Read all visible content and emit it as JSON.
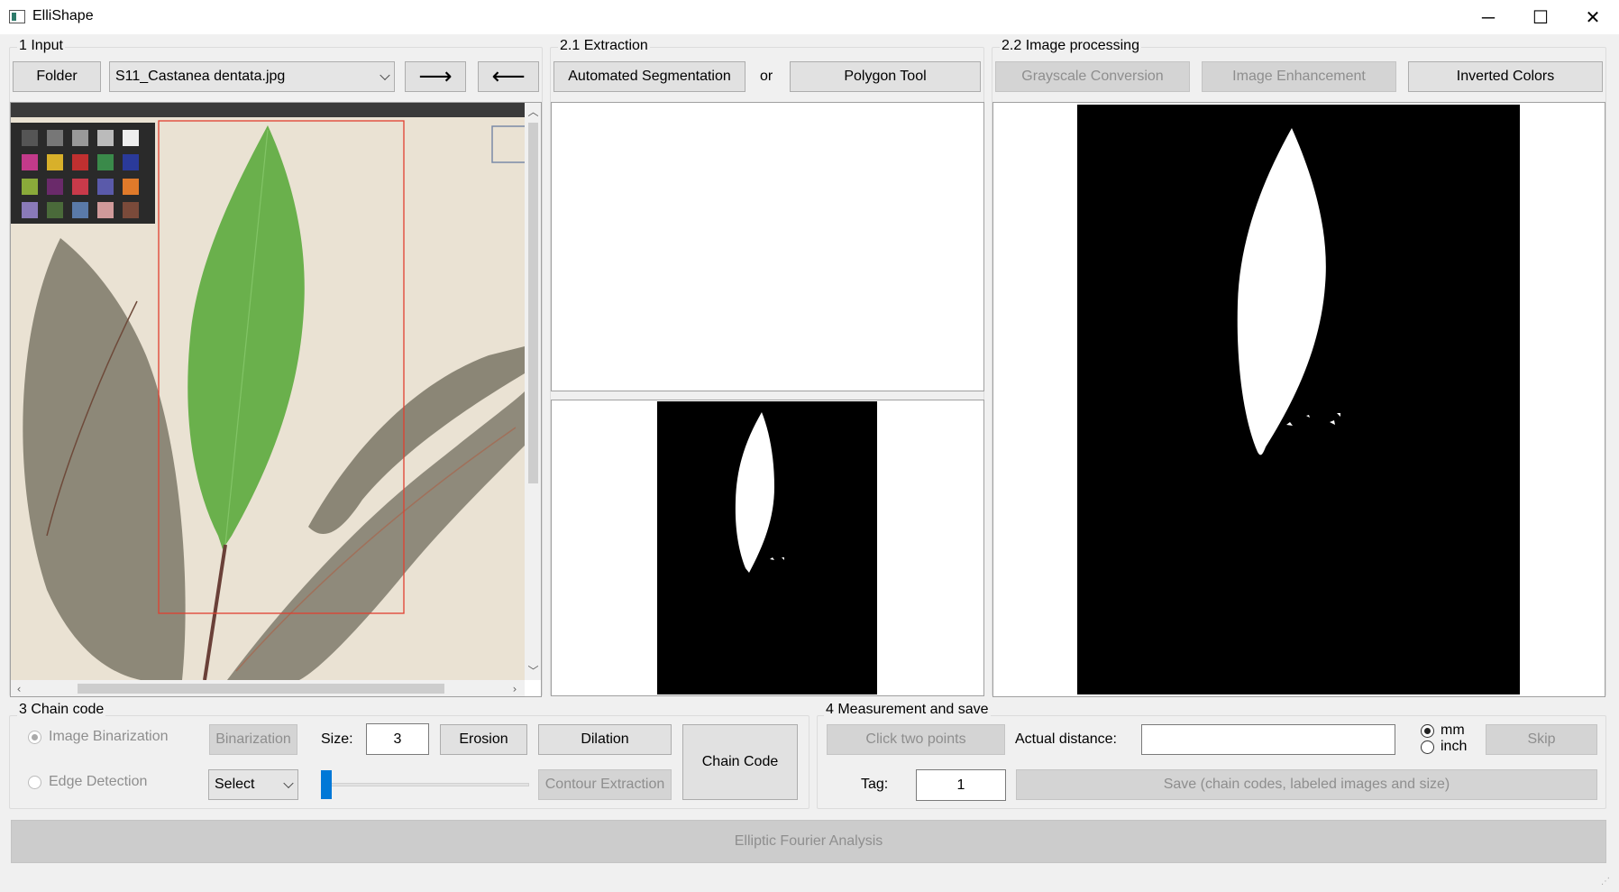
{
  "window": {
    "title": "ElliShape",
    "minimize": "─",
    "maximize": "☐",
    "close": "✕"
  },
  "input_group": {
    "label": "1 Input",
    "folder_button": "Folder",
    "file_select": "S11_Castanea dentata.jpg",
    "next_button": "⟶",
    "prev_button": "⟵"
  },
  "extraction_group": {
    "label": "2.1 Extraction",
    "auto_seg_button": "Automated Segmentation",
    "or_text": "or",
    "polygon_button": "Polygon Tool"
  },
  "processing_group": {
    "label": "2.2 Image processing",
    "grayscale_button": "Grayscale Conversion",
    "enhancement_button": "Image Enhancement",
    "invert_button": "Inverted Colors"
  },
  "chain_group": {
    "label": "3 Chain code",
    "binarization_radio": "Image Binarization",
    "edge_radio": "Edge Detection",
    "binarization_button": "Binarization",
    "size_label": "Size:",
    "size_value": "3",
    "erosion_button": "Erosion",
    "dilation_button": "Dilation",
    "select_value": "Select",
    "contour_button": "Contour Extraction",
    "chain_button": "Chain Code"
  },
  "measure_group": {
    "label": "4 Measurement and save",
    "click_points_button": "Click two points",
    "distance_label": "Actual distance:",
    "distance_value": "",
    "unit_mm": "mm",
    "unit_inch": "inch",
    "skip_button": "Skip",
    "tag_label": "Tag:",
    "tag_value": "1",
    "save_button": "Save (chain codes, labeled images and size)"
  },
  "efa_button": "Elliptic Fourier Analysis",
  "colors": {
    "leaf_green": "#6ab04c",
    "paper": "#eae2d3",
    "dried_leaf": "#8d8878",
    "bbox_red": "#e04030"
  }
}
